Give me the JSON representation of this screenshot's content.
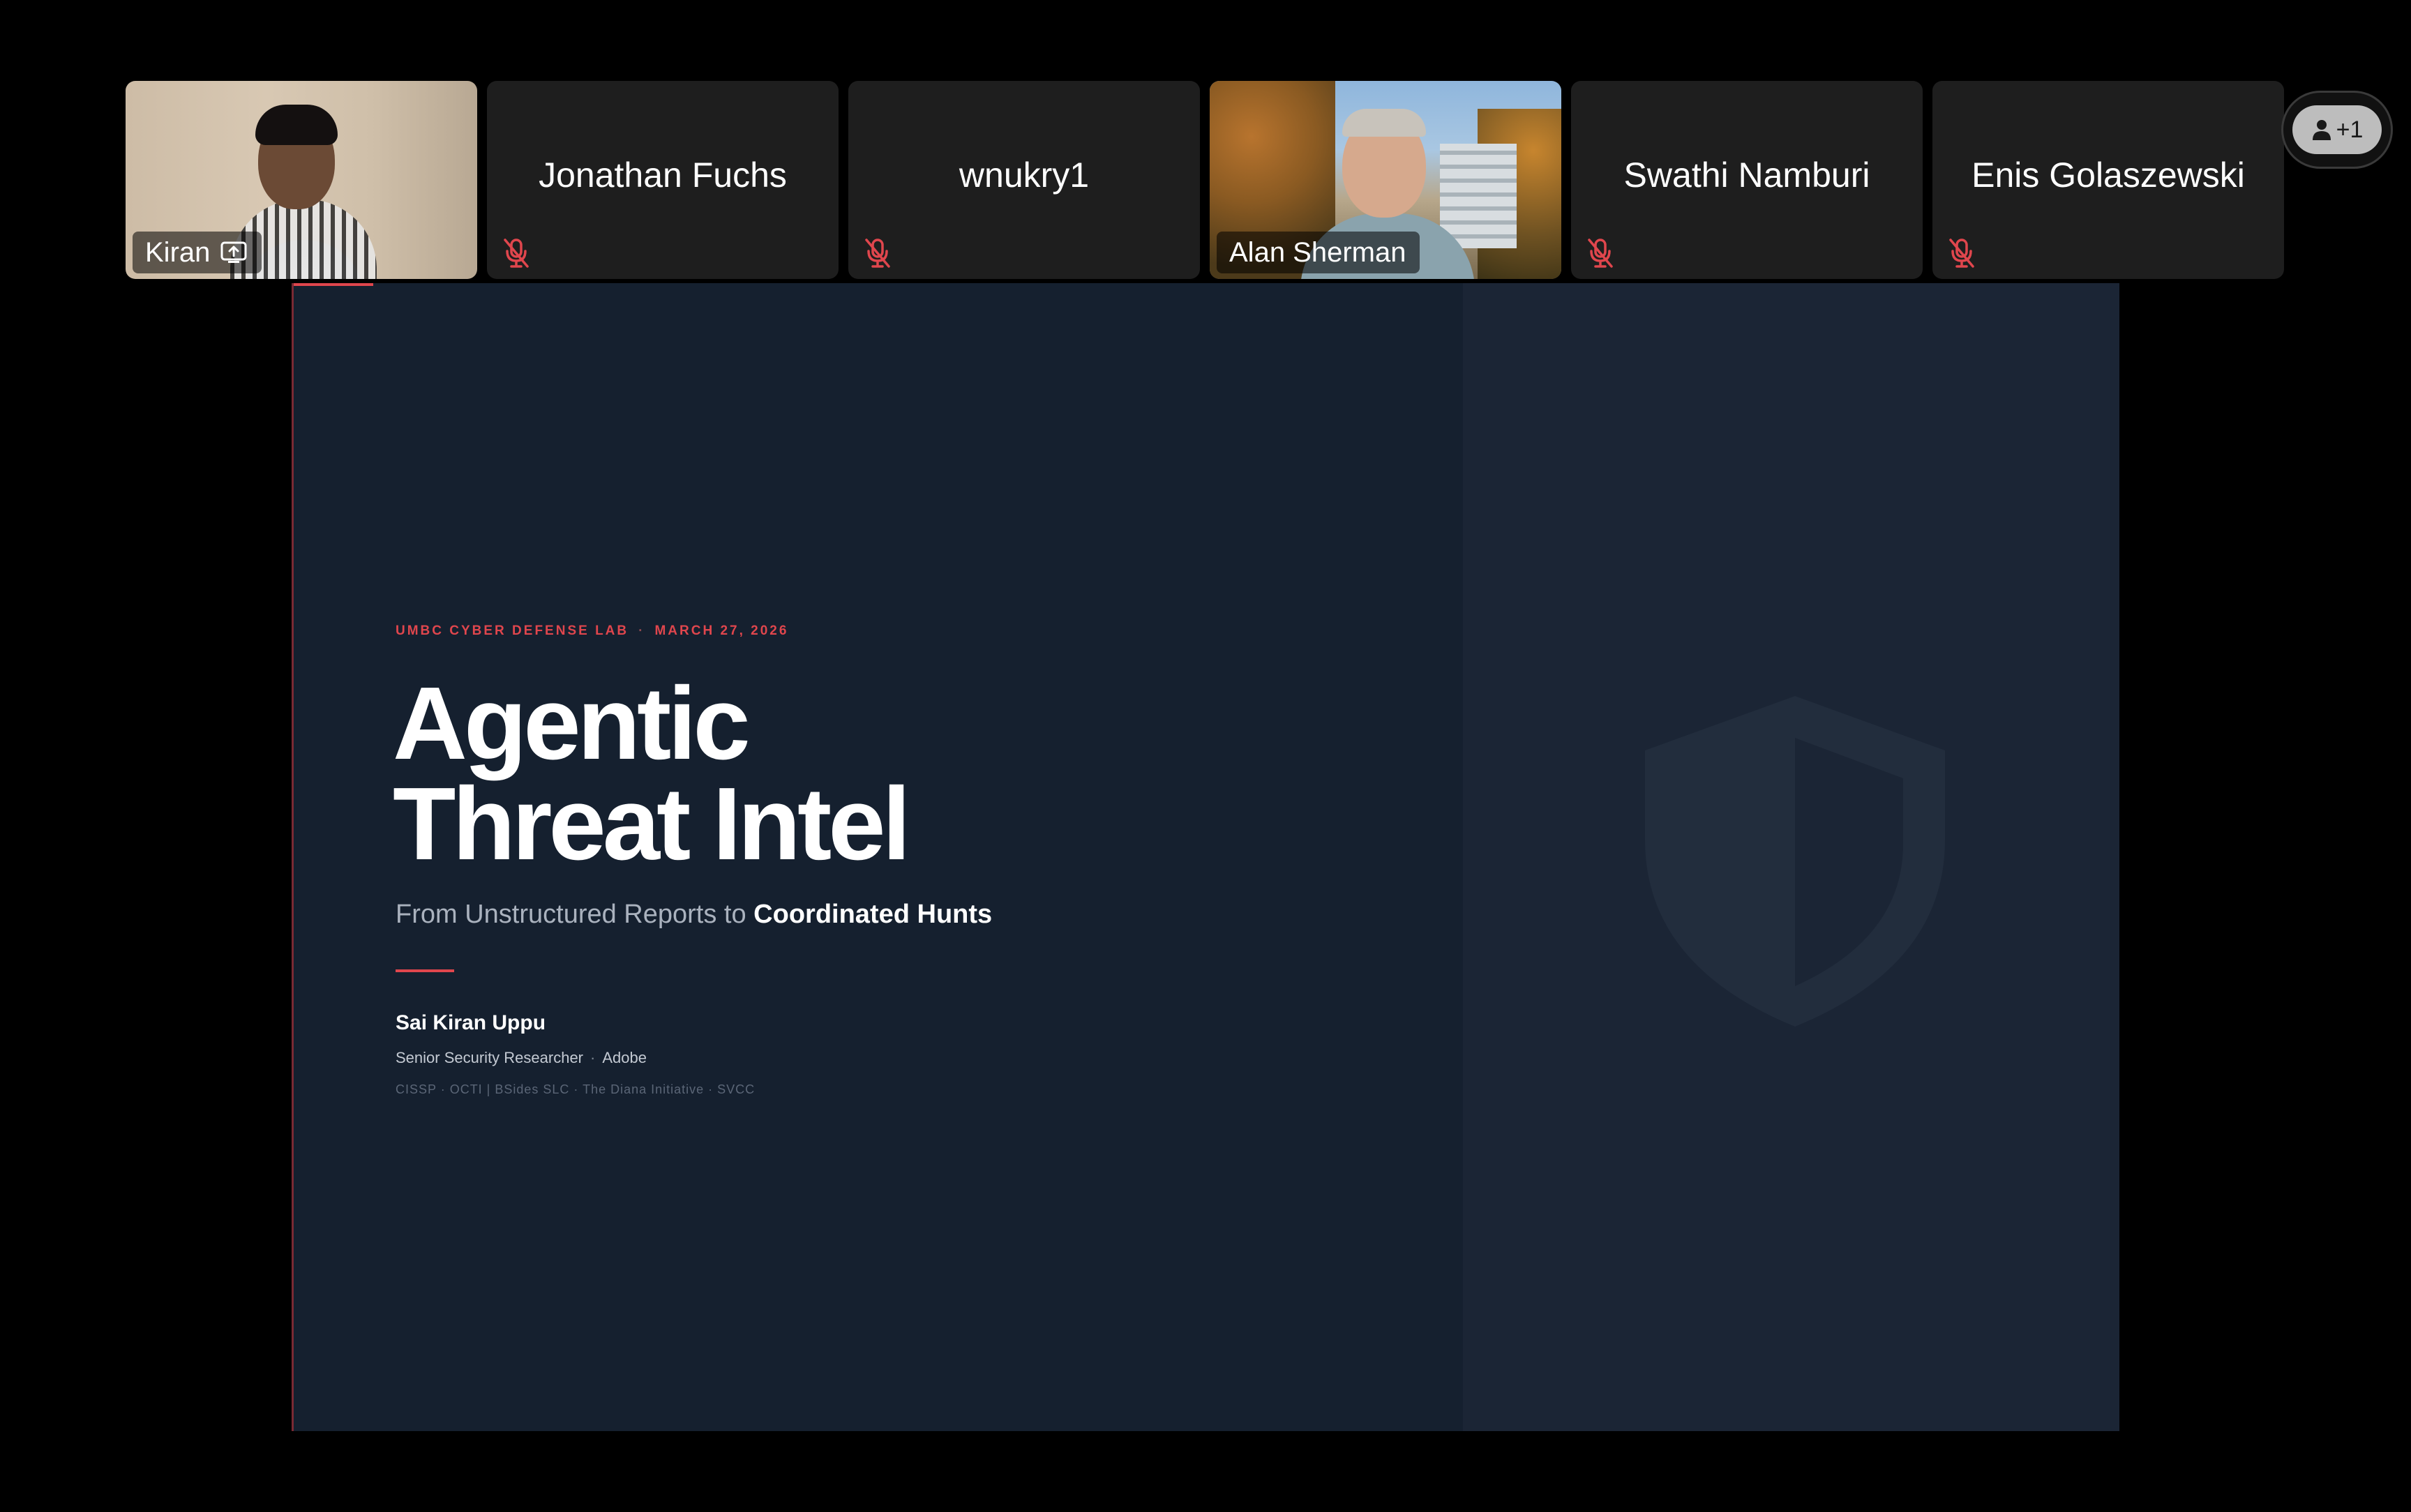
{
  "participants": [
    {
      "name": "Kiran",
      "video": true,
      "muted": false,
      "sharing": true
    },
    {
      "name": "Jonathan Fuchs",
      "video": false,
      "muted": true
    },
    {
      "name": "wnukry1",
      "video": false,
      "muted": true
    },
    {
      "name": "Alan Sherman",
      "video": true,
      "muted": false
    },
    {
      "name": "Swathi Namburi",
      "video": false,
      "muted": true
    },
    {
      "name": "Enis Golaszewski",
      "video": false,
      "muted": true
    }
  ],
  "overflow": {
    "label": "+1",
    "icon": "person-icon"
  },
  "slide": {
    "eyebrow_org": "UMBC CYBER DEFENSE LAB",
    "eyebrow_sep": "·",
    "eyebrow_date": "MARCH 27, 2026",
    "title_line1": "Agentic",
    "title_line2": "Threat Intel",
    "subtitle_prefix": "From Unstructured Reports to",
    "subtitle_emphasis": "Coordinated Hunts",
    "author": "Sai Kiran Uppu",
    "role_title": "Senior Security Researcher",
    "role_sep": "·",
    "role_company": "Adobe",
    "credentials": "CISSP · OCTI  |  BSides SLC · The Diana Initiative · SVCC",
    "watermark_icon": "shield-icon"
  },
  "colors": {
    "background": "#000000",
    "tile": "#1e1e1e",
    "slide_bg": "#15202f",
    "slide_panel": "#1b2535",
    "accent_red": "#e0464d",
    "mute_red": "#e0464d"
  }
}
